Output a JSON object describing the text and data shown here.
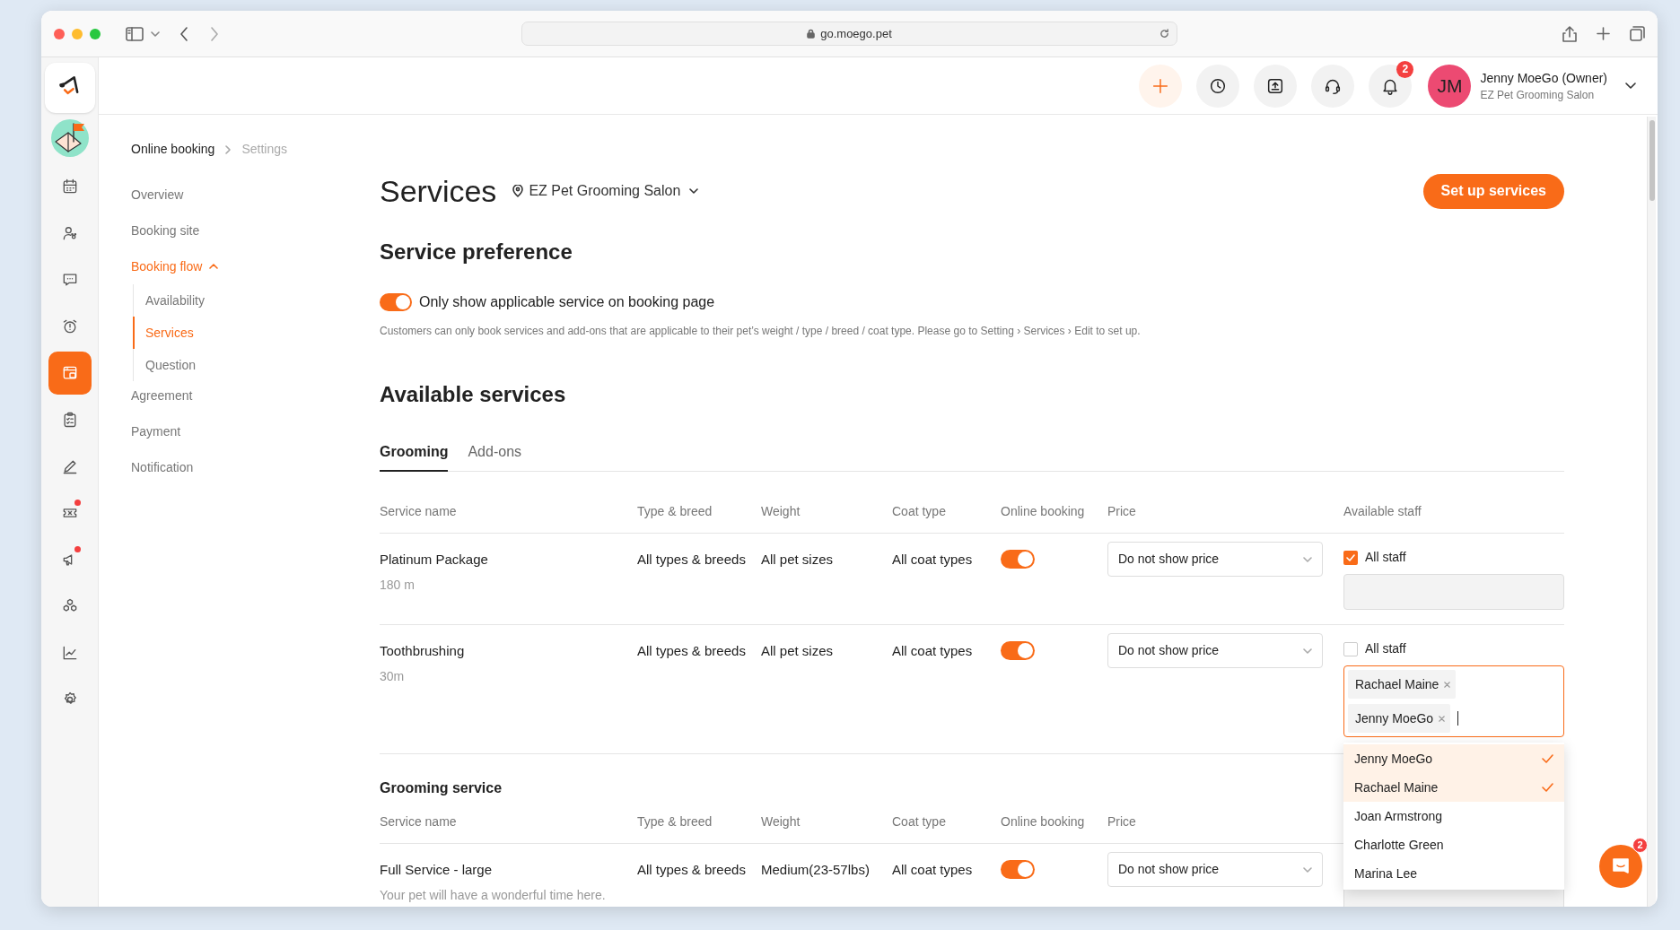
{
  "browser": {
    "url": "go.moego.pet"
  },
  "rail": {
    "items": [
      {
        "selected": false,
        "dot": false
      },
      {
        "selected": false,
        "dot": false
      },
      {
        "selected": false,
        "dot": false
      },
      {
        "selected": false,
        "dot": false
      },
      {
        "selected": false,
        "dot": false
      },
      {
        "selected": false,
        "dot": false
      },
      {
        "selected": true,
        "dot": false
      },
      {
        "selected": false,
        "dot": false
      },
      {
        "selected": false,
        "dot": false
      },
      {
        "selected": false,
        "dot": true
      },
      {
        "selected": false,
        "dot": true
      },
      {
        "selected": false,
        "dot": false
      },
      {
        "selected": false,
        "dot": false
      },
      {
        "selected": false,
        "dot": false
      }
    ]
  },
  "header": {
    "notification_count": "2",
    "user": {
      "initials": "JM",
      "name": "Jenny MoeGo (Owner)",
      "business": "EZ Pet Grooming Salon"
    }
  },
  "settings_nav": {
    "breadcrumb": [
      "Online booking",
      "Settings"
    ],
    "items": [
      {
        "label": "Overview",
        "selected": false
      },
      {
        "label": "Booking site",
        "selected": false
      },
      {
        "label": "Booking flow",
        "selected": true,
        "expanded": true,
        "children": [
          {
            "label": "Availability",
            "selected": false
          },
          {
            "label": "Services",
            "selected": true
          },
          {
            "label": "Question",
            "selected": false
          }
        ]
      },
      {
        "label": "Agreement",
        "selected": false
      },
      {
        "label": "Payment",
        "selected": false
      },
      {
        "label": "Notification",
        "selected": false
      }
    ]
  },
  "page": {
    "title": "Services",
    "location": "EZ Pet Grooming Salon",
    "action": "Set up services"
  },
  "service_preference": {
    "heading": "Service preference",
    "toggle": {
      "label": "Only show applicable service on booking page",
      "on": true
    },
    "note": "Customers can only book services and add-ons that are applicable to their pet’s weight / type / breed / coat type. Please go to Setting › Services › Edit to set up."
  },
  "available_services": {
    "heading": "Available services",
    "tabs": [
      {
        "label": "Grooming",
        "selected": true
      },
      {
        "label": "Add-ons",
        "selected": false
      }
    ],
    "tables": [
      {
        "columns": [
          "Service name",
          "Type & breed",
          "Weight",
          "Coat type",
          "Online booking",
          "Price",
          "Available staff"
        ],
        "rows": [
          {
            "name": "Platinum Package",
            "detail": "180 m",
            "type_breed": "All types & breeds",
            "weight": "All pet sizes",
            "coat_type": "All coat types",
            "online_booking": true,
            "price": "Do not show price",
            "all_staff": {
              "label": "All staff",
              "checked": true
            },
            "staff_field": {
              "disabled": true
            }
          },
          {
            "name": "Toothbrushing",
            "detail": "30m",
            "type_breed": "All types & breeds",
            "weight": "All pet sizes",
            "coat_type": "All coat types",
            "online_booking": true,
            "price": "Do not show price",
            "all_staff": {
              "label": "All staff",
              "checked": false
            },
            "staff_field": {
              "disabled": false,
              "focused": true,
              "tags": [
                "Rachael Maine",
                "Jenny MoeGo"
              ]
            },
            "dropdown": [
              {
                "label": "Jenny MoeGo",
                "selected": true
              },
              {
                "label": "Rachael Maine",
                "selected": true
              },
              {
                "label": "Joan Armstrong",
                "selected": false
              },
              {
                "label": "Charlotte Green",
                "selected": false
              },
              {
                "label": "Marina Lee",
                "selected": false
              }
            ]
          }
        ]
      },
      {
        "title": "Grooming service",
        "columns": [
          "Service name",
          "Type & breed",
          "Weight",
          "Coat type",
          "Online booking",
          "Price"
        ],
        "rows": [
          {
            "name": "Full Service - large",
            "detail": "Your pet will have a wonderful time here.",
            "type_breed": "All types & breeds",
            "weight": "Medium(23-57lbs)",
            "coat_type": "All coat types",
            "online_booking": true,
            "price": "Do not show price",
            "staff_field": {
              "disabled": true
            }
          }
        ]
      }
    ]
  },
  "chat": {
    "badge": "2"
  }
}
